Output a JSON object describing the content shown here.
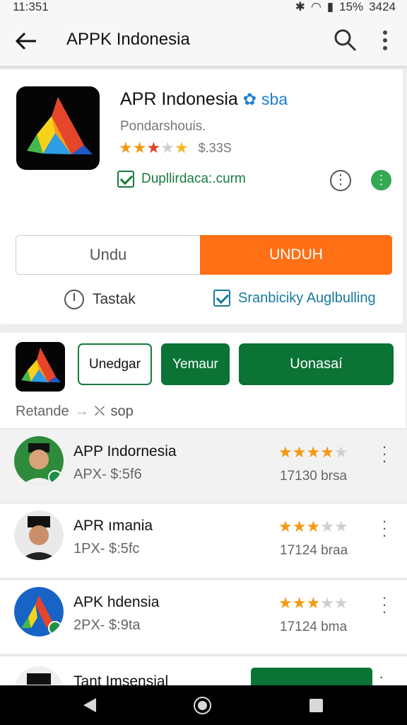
{
  "status_bar": {
    "time": "11:351",
    "battery": "15%",
    "right_value": "3424"
  },
  "app_bar": {
    "title": "APPK Indonesia"
  },
  "app": {
    "title": "APR Indonesia",
    "verified_label": "sba",
    "developer": "Pondarshouis.",
    "rating": 3.5,
    "price": "$.33S",
    "website": "Dupllirdaca:.curm"
  },
  "actions": {
    "secondary_label": "Undu",
    "primary_label": "UNDUH"
  },
  "features": {
    "first": "Tastak",
    "second": "Sranbiciky Auglbulling"
  },
  "chips": {
    "first": "Unedgar",
    "second": "Yemaur",
    "third": "Uonasaí"
  },
  "breadcrumb": {
    "left": "Retande",
    "right": "sop"
  },
  "list": {
    "items": [
      {
        "name": "APP Indornesia",
        "price": "APX- $:5f6",
        "stars": 4,
        "count": "17130 brsa"
      },
      {
        "name": "APR ımania",
        "price": "1PX- $:5fc",
        "stars": 3,
        "count": "17124 braa"
      },
      {
        "name": "APK hdensia",
        "price": "2PX- $:9ta",
        "stars": 3,
        "count": "17124 bma"
      },
      {
        "name": "Tant Imsensial"
      }
    ]
  },
  "colors": {
    "accent": "#ff6f15",
    "primary_green": "#0b7335",
    "link_green": "#177b3e",
    "link_blue": "#177b9b",
    "star": "#f29a12"
  }
}
